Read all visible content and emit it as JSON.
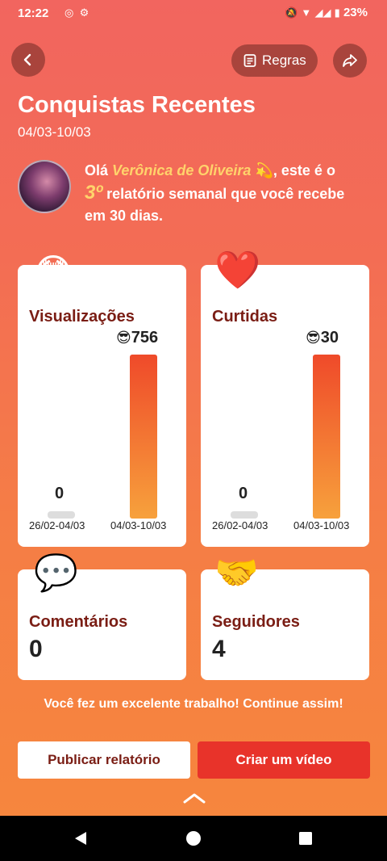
{
  "status": {
    "time": "12:22",
    "battery": "23%"
  },
  "header": {
    "rules_label": "Regras",
    "title": "Conquistas Recentes",
    "date_range": "04/03-10/03"
  },
  "intro": {
    "greeting": "Olá",
    "name": "Verônica de Oliveira",
    "name_emoji": "💫",
    "part1": ", este é",
    "part2": "o",
    "ordinal": "3º",
    "part3": "relatório semanal que você recebe em 30 dias."
  },
  "cards": {
    "views": {
      "emoji": "😳",
      "label": "Visualizações",
      "prev_value": "0",
      "curr_value": "756",
      "curr_emoji": "😎",
      "prev_period": "26/02-04/03",
      "curr_period": "04/03-10/03"
    },
    "likes": {
      "emoji": "❤️",
      "label": "Curtidas",
      "prev_value": "0",
      "curr_value": "30",
      "curr_emoji": "😎",
      "prev_period": "26/02-04/03",
      "curr_period": "04/03-10/03"
    },
    "comments": {
      "emoji": "💬",
      "label": "Comentários",
      "value": "0"
    },
    "followers": {
      "emoji": "🤝",
      "label": "Seguidores",
      "value": "4"
    }
  },
  "footer": {
    "message": "Você fez um excelente trabalho! Continue assim!",
    "publish_label": "Publicar relatório",
    "create_label": "Criar um vídeo"
  },
  "colors": {
    "accent": "#e8332a",
    "title_dark": "#7a1d14",
    "highlight": "#ffd36b"
  }
}
